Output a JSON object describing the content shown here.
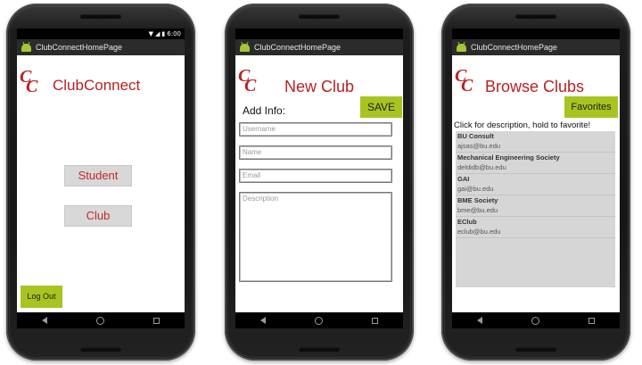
{
  "status": {
    "time": "6:00"
  },
  "app_name": "ClubConnectHomePage",
  "logo": {
    "letters": "CC"
  },
  "screen1": {
    "title": "ClubConnect",
    "student_label": "Student",
    "club_label": "Club",
    "logout_label": "Log Out"
  },
  "screen2": {
    "title": "New Club",
    "add_info_label": "Add Info:",
    "save_label": "SAVE",
    "fields": {
      "username_placeholder": "Username",
      "name_placeholder": "Name",
      "email_placeholder": "Email",
      "description_placeholder": "Description"
    }
  },
  "screen3": {
    "title": "Browse Clubs",
    "favorites_label": "Favorites",
    "hint": "Click for description, hold to favorite!",
    "clubs": [
      {
        "name": "BU Consult",
        "email": "ajsas@bu.edu"
      },
      {
        "name": "Mechanical Engineering Society",
        "email": "deldidb@bu.edu"
      },
      {
        "name": "GAI",
        "email": "gai@bu.edu"
      },
      {
        "name": "BME Society",
        "email": "bme@bu.edu"
      },
      {
        "name": "EClub",
        "email": "eclub@bu.edu"
      }
    ]
  },
  "colors": {
    "accent_red": "#b82222",
    "button_green": "#a8c421"
  },
  "icons": {
    "nav": [
      "back-icon",
      "home-icon",
      "recents-icon"
    ],
    "status": [
      "wifi-icon",
      "signal-icon",
      "battery-icon"
    ]
  }
}
